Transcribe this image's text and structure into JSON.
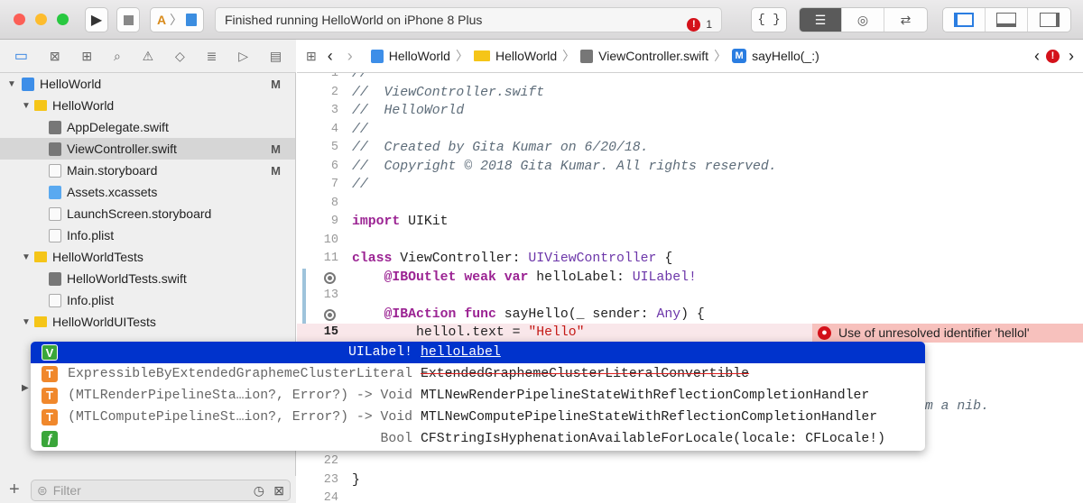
{
  "toolbar": {
    "status": "Finished running HelloWorld on iPhone 8 Plus",
    "error_count": "1"
  },
  "navigator": {
    "items": [
      {
        "label": "HelloWorld",
        "flag": "M"
      },
      {
        "label": "HelloWorld"
      },
      {
        "label": "AppDelegate.swift"
      },
      {
        "label": "ViewController.swift",
        "flag": "M"
      },
      {
        "label": "Main.storyboard",
        "flag": "M"
      },
      {
        "label": "Assets.xcassets"
      },
      {
        "label": "LaunchScreen.storyboard"
      },
      {
        "label": "Info.plist"
      },
      {
        "label": "HelloWorldTests"
      },
      {
        "label": "HelloWorldTests.swift"
      },
      {
        "label": "Info.plist"
      },
      {
        "label": "HelloWorldUITests"
      }
    ],
    "filter_placeholder": "Filter"
  },
  "jumpbar": [
    "HelloWorld",
    "HelloWorld",
    "ViewController.swift",
    "sayHello(_:)"
  ],
  "editor": {
    "lines": {
      "l1": "//",
      "l2": "//  ViewController.swift",
      "l3": "//  HelloWorld",
      "l4": "//",
      "l5": "//  Created by Gita Kumar on 6/20/18.",
      "l6": "//  Copyright © 2018 Gita Kumar. All rights reserved.",
      "l7": "//",
      "l9a": "import",
      "l9b": " UIKit",
      "l11a": "class",
      "l11b": " ViewController: ",
      "l11c": "UIViewController",
      "l11d": " {",
      "l12a": "    @IBOutlet weak var",
      "l12b": " helloLabel: ",
      "l12c": "UILabel!",
      "l14a": "    @IBAction func",
      "l14b": " sayHello(_ sender: ",
      "l14c": "Any",
      "l14d": ") {",
      "l15a": "        hellol.text = ",
      "l15b": "\"Hello\"",
      "l19": "om a nib.",
      "l23": "}"
    },
    "error_message": "Use of unresolved identifier 'hellol'"
  },
  "completions": [
    {
      "badge": "V",
      "type": "UILabel!",
      "name": "helloLabel",
      "color": "#3aa63a"
    },
    {
      "badge": "T",
      "type": "ExpressibleByExtendedGraphemeClusterLiteral",
      "name": "ExtendedGraphemeClusterLiteralConvertible",
      "color": "#f0882c"
    },
    {
      "badge": "T",
      "type": "(MTLRenderPipelineSta…ion?, Error?) -> Void",
      "name": "MTLNewRenderPipelineStateWithReflectionCompletionHandler",
      "color": "#f0882c"
    },
    {
      "badge": "T",
      "type": "(MTLComputePipelineSt…ion?, Error?) -> Void",
      "name": "MTLNewComputePipelineStateWithReflectionCompletionHandler",
      "color": "#f0882c"
    },
    {
      "badge": "ƒ",
      "type": "Bool",
      "name": "CFStringIsHyphenationAvailableForLocale(locale: CFLocale!)",
      "color": "#3aa63a"
    }
  ]
}
